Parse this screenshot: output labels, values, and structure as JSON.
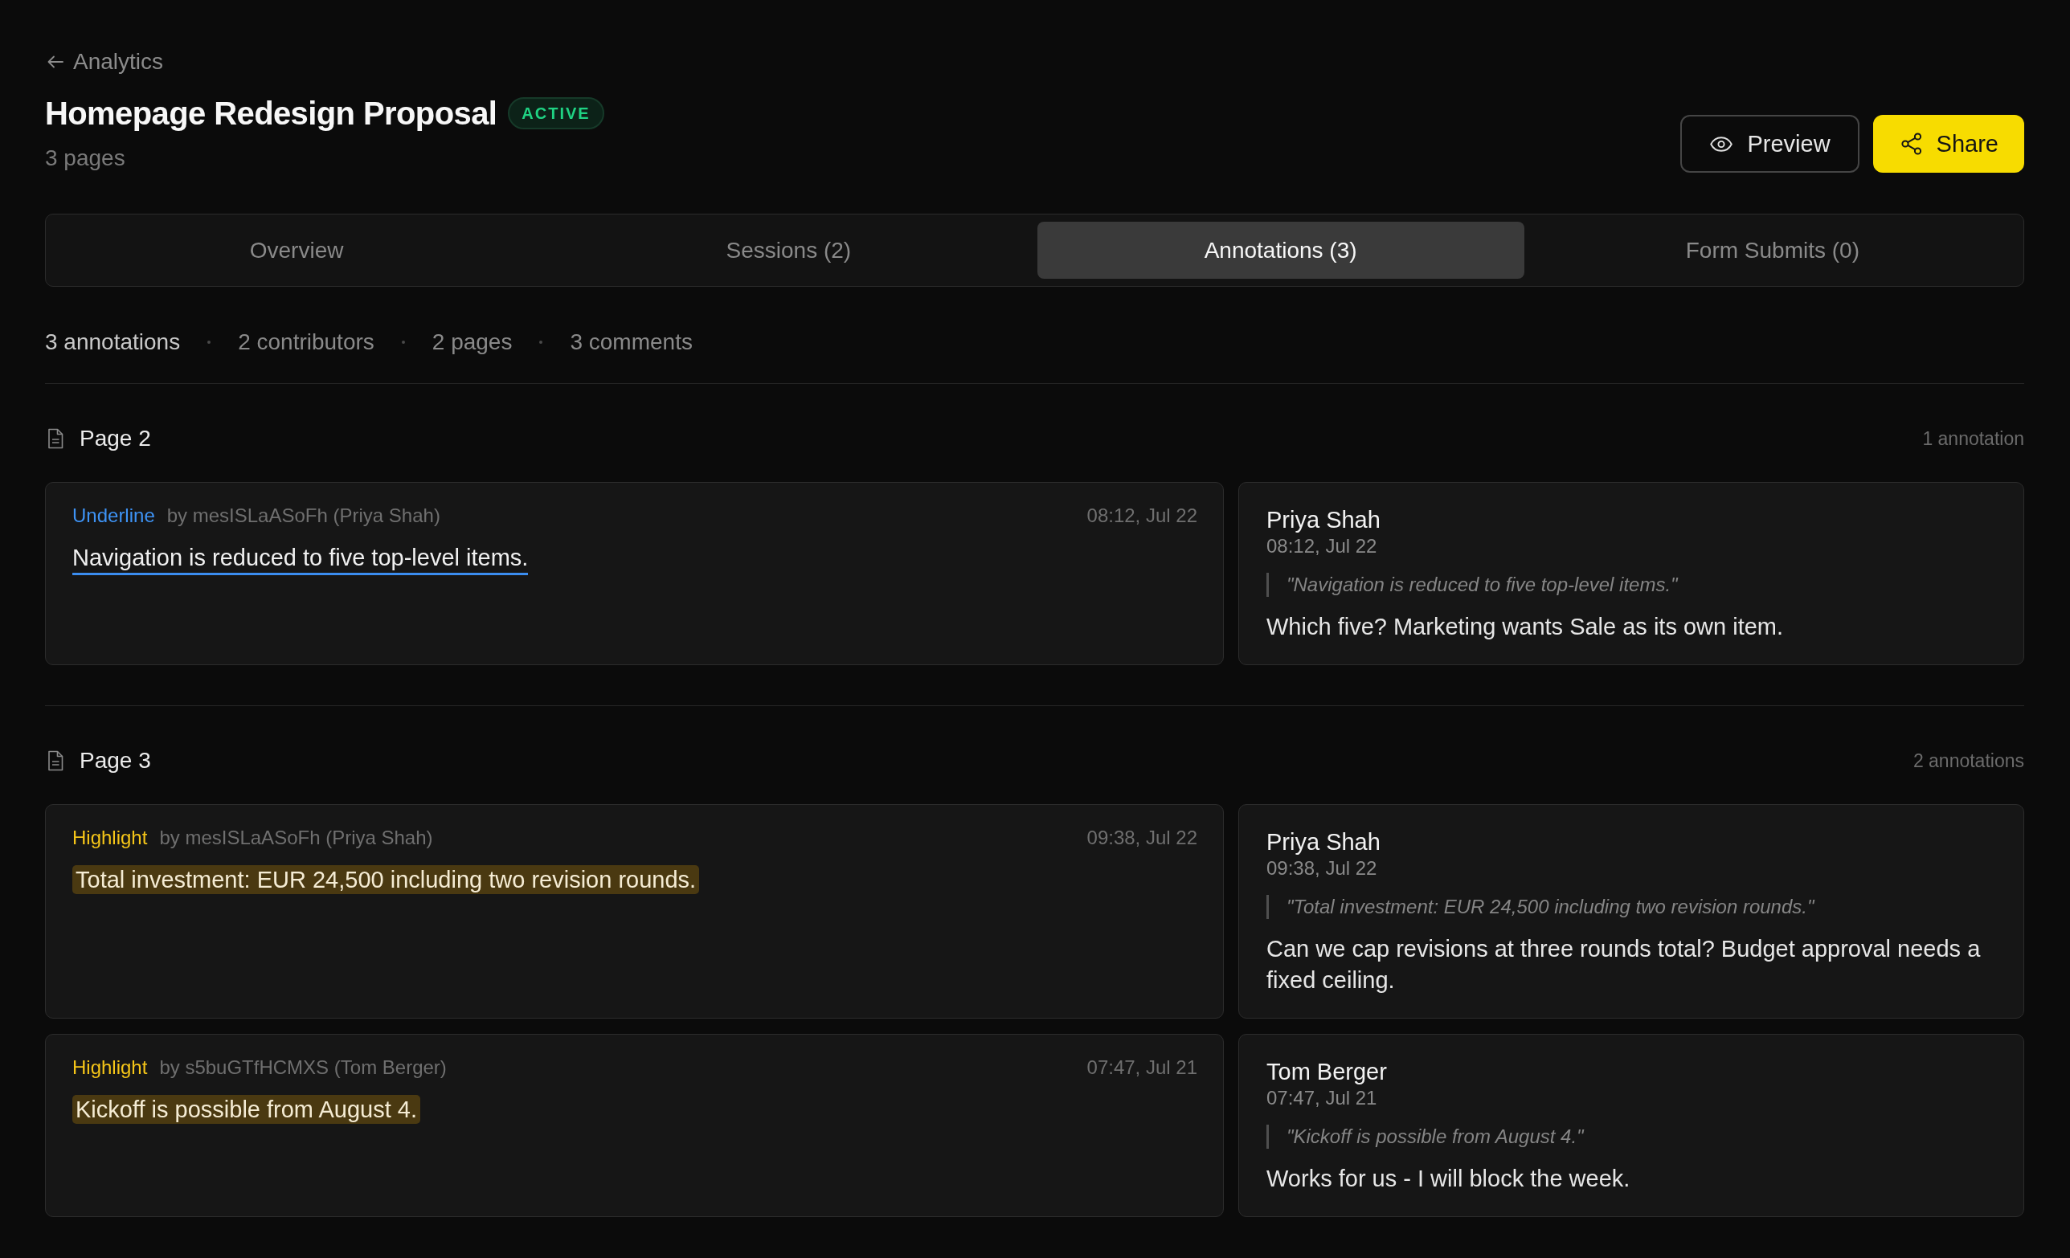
{
  "back_link": {
    "label": "Analytics"
  },
  "header": {
    "title": "Homepage Redesign Proposal",
    "status": {
      "label": "ACTIVE",
      "kind": "success"
    },
    "subtitle": "3 pages"
  },
  "preview_button": {
    "label": "Preview"
  },
  "share_button": {
    "label": "Share"
  },
  "tabs": [
    {
      "label": "Overview",
      "selected": false
    },
    {
      "label": "Sessions (2)",
      "selected": false
    },
    {
      "label": "Annotations (3)",
      "selected": true
    },
    {
      "label": "Form Submits (0)",
      "selected": false
    }
  ],
  "stats": [
    {
      "label": "3 annotations",
      "primary": true
    },
    {
      "label": "2 contributors",
      "primary": false
    },
    {
      "label": "2 pages",
      "primary": false
    },
    {
      "label": "3 comments",
      "primary": false
    }
  ],
  "groups": [
    {
      "title": "Page 2",
      "count": "1 annotation",
      "items": [
        {
          "annotation": {
            "kind": "underline",
            "kind_label": "Underline",
            "author": "by mesISLaASoFh (Priya Shah)",
            "time": "08:12, Jul 22",
            "text": "Navigation is reduced to five top-level items."
          },
          "comment": {
            "author": "Priya Shah",
            "time": "08:12, Jul 22",
            "quote": "\"Navigation is reduced to five top-level items.\"",
            "body": "Which five? Marketing wants Sale as its own item."
          }
        }
      ]
    },
    {
      "title": "Page 3",
      "count": "2 annotations",
      "items": [
        {
          "annotation": {
            "kind": "highlight",
            "kind_label": "Highlight",
            "author": "by mesISLaASoFh (Priya Shah)",
            "time": "09:38, Jul 22",
            "text": "Total investment: EUR 24,500 including two revision rounds."
          },
          "comment": {
            "author": "Priya Shah",
            "time": "09:38, Jul 22",
            "quote": "\"Total investment: EUR 24,500 including two revision rounds.\"",
            "body": "Can we cap revisions at three rounds total? Budget approval needs a fixed ceiling."
          }
        },
        {
          "annotation": {
            "kind": "highlight",
            "kind_label": "Highlight",
            "author": "by s5buGTfHCMXS (Tom Berger)",
            "time": "07:47, Jul 21",
            "text": "Kickoff is possible from August 4."
          },
          "comment": {
            "author": "Tom Berger",
            "time": "07:47, Jul 21",
            "quote": "\"Kickoff is possible from August 4.\"",
            "body": "Works for us - I will block the week."
          }
        }
      ]
    }
  ]
}
